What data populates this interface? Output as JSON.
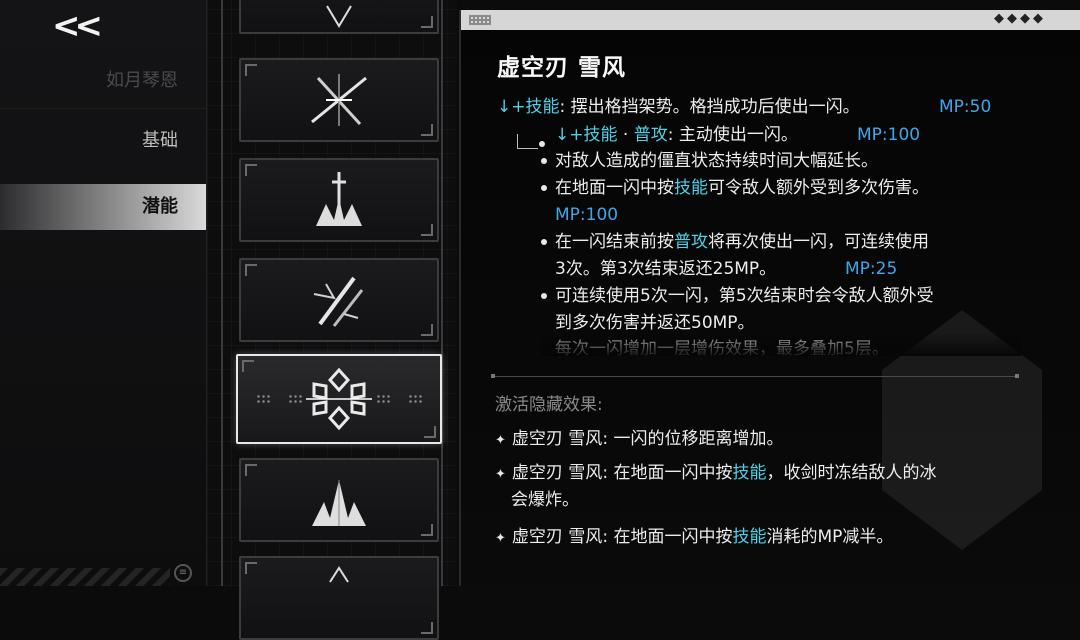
{
  "nav": {
    "back": "<<",
    "items": [
      {
        "label": "如月琴恩"
      },
      {
        "label": "基础"
      },
      {
        "label": "潜能"
      }
    ]
  },
  "skill_cards": [
    {
      "icon": "cross-slash-icon"
    },
    {
      "icon": "ice-sword-burst-icon"
    },
    {
      "icon": "claw-slash-icon"
    },
    {
      "icon": "snowflake-core-icon"
    },
    {
      "icon": "ice-crystal-icon"
    }
  ],
  "detail": {
    "title": "虚空刃 雪风",
    "line1": {
      "arrow": "↓+",
      "skill": "技能",
      "text": ": 摆出格挡架势。格挡成功后使出一闪。",
      "mp": "MP:50"
    },
    "line2": {
      "arrow": "↓+",
      "skill": "技能",
      "dot": " · ",
      "attack": "普攻",
      "text": ": 主动使出一闪。",
      "mp": "MP:100"
    },
    "bullet1": "对敌人造成的僵直状态持续时间大幅延长。",
    "bullet2": {
      "pre": "在地面一闪中按",
      "skill": "技能",
      "post": "可令敌人额外受到多次伤害。",
      "mp": "MP:100"
    },
    "bullet3": {
      "pre": "在一闪结束前按",
      "attack": "普攻",
      "post": "将再次使出一闪，可连续使用",
      "line2": "3次。第3次结束返还25MP。",
      "mp": "MP:25"
    },
    "bullet4": {
      "line1": "可连续使用5次一闪，第5次结束时会令敌人额外受",
      "line2": "到多次伤害并返还50MP。"
    },
    "bullet5": "每次一闪增加一层增伤效果，最多叠加5层。",
    "hidden_title": "激活隐藏效果:",
    "hidden": [
      {
        "name": "虚空刃 雪风",
        "text": ": 一闪的位移距离增加。"
      },
      {
        "name": "虚空刃 雪风",
        "pre": ": 在地面一闪中按",
        "skill": "技能",
        "post": "，收剑时冻结敌人的冰",
        "line2": "会爆炸。"
      },
      {
        "name": "虚空刃 雪风",
        "pre": ": 在地面一闪中按",
        "skill": "技能",
        "post": "消耗的MP减半。"
      }
    ]
  },
  "colors": {
    "cyan": "#4fd0e6",
    "mp": "#3fa7e8",
    "active_tab": "#d9d9d9"
  }
}
